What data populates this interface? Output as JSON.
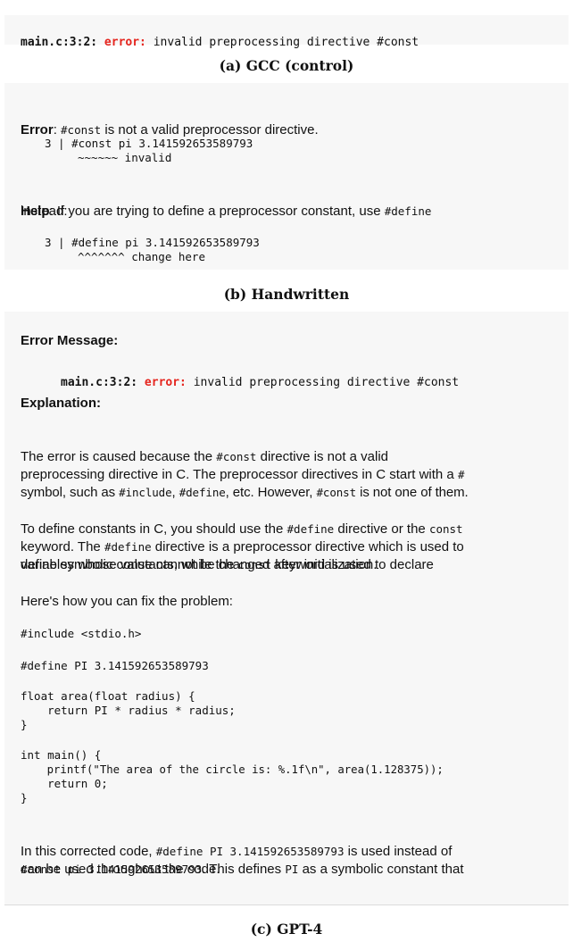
{
  "panel_a": {
    "loc": "main.c:3:2:",
    "error_kw": "error:",
    "message": "invalid preprocessing directive #const",
    "caption": "(a) GCC (control)"
  },
  "panel_b": {
    "error_label": "Error",
    "error_sep": ":",
    "error_code": "#const",
    "error_rest": "is not a valid preprocessor directive.",
    "snippet1_line": "3 | #const pi 3.141592653589793",
    "snippet1_marker": "~~~~~~ invalid",
    "help_label": "Help",
    "help_text_1": ": If you are trying to define a preprocessor constant, use",
    "help_code": "#define",
    "help_text_2": "instead:",
    "snippet2_line": "3 | #define pi 3.141592653589793",
    "snippet2_marker": "^^^^^^^ change here",
    "caption": "(b) Handwritten"
  },
  "panel_c": {
    "h_error": "Error Message:",
    "err_loc": "main.c:3:2:",
    "err_kw": "error:",
    "err_msg": "invalid preprocessing directive #const",
    "h_expl": "Explanation:",
    "p1": {
      "a": "The error is caused because the",
      "code1": "#const",
      "b": "directive is not a valid",
      "line2": "preprocessing directive in C. The preprocessor directives in C start with a",
      "code2": "#",
      "c": "symbol, such as",
      "code3": "#include",
      "d": ",",
      "code4": "#define",
      "e": ", etc. However,",
      "code5": "#const",
      "f": "is not one of them."
    },
    "p2": {
      "a": "To define constants in C, you should use the",
      "code1": "#define",
      "b": "directive or the",
      "code2": "const",
      "c": "keyword. The",
      "code3": "#define",
      "d": "directive is a preprocessor directive which is used to",
      "line3": "define symbolic constants, while the",
      "code4": "const",
      "e": "keyword is used to declare",
      "line4": "variables whose value cannot be changed after initialization."
    },
    "p3": "Here's how you can fix the problem:",
    "code": [
      "#include <stdio.h>",
      "",
      "#define PI 3.141592653589793",
      "",
      "float area(float radius) {",
      "    return PI * radius * radius;",
      "}",
      "",
      "int main() {",
      "    printf(\"The area of the circle is: %.1f\\n\", area(1.128375));",
      "    return 0;",
      "}"
    ],
    "p4": {
      "a": "In this corrected code,",
      "code1": "#define PI 3.141592653589793",
      "b": "is used instead of",
      "code2": "#const pi 3.141592653589793",
      "c": ". This defines",
      "code3": "PI",
      "d": "as a symbolic constant that",
      "line3": "can be used throughout the code."
    },
    "caption": "(c) GPT-4"
  }
}
